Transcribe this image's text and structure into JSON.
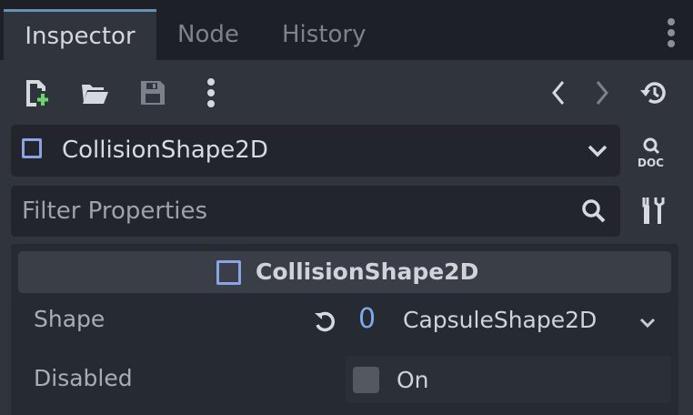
{
  "tabs": [
    {
      "label": "Inspector",
      "active": true
    },
    {
      "label": "Node",
      "active": false
    },
    {
      "label": "History",
      "active": false
    }
  ],
  "toolbar": {
    "icons": [
      "new-resource-icon",
      "open-folder-icon",
      "save-icon",
      "more-vertical-icon",
      "back-icon",
      "forward-icon",
      "history-icon"
    ]
  },
  "node_selector": {
    "name": "CollisionShape2D",
    "accent": "#8aa3e6"
  },
  "filter": {
    "placeholder": "Filter Properties"
  },
  "section": {
    "title": "CollisionShape2D"
  },
  "properties": [
    {
      "label": "Shape",
      "revert_value": "0",
      "value": "CapsuleShape2D"
    },
    {
      "label": "Disabled",
      "checkbox_label": "On",
      "checked": false
    }
  ],
  "colors": {
    "background": "#30343b",
    "field": "#22252c",
    "accent_blue": "#7da8ee",
    "active_tab_indicator": "#6a8fb3"
  }
}
